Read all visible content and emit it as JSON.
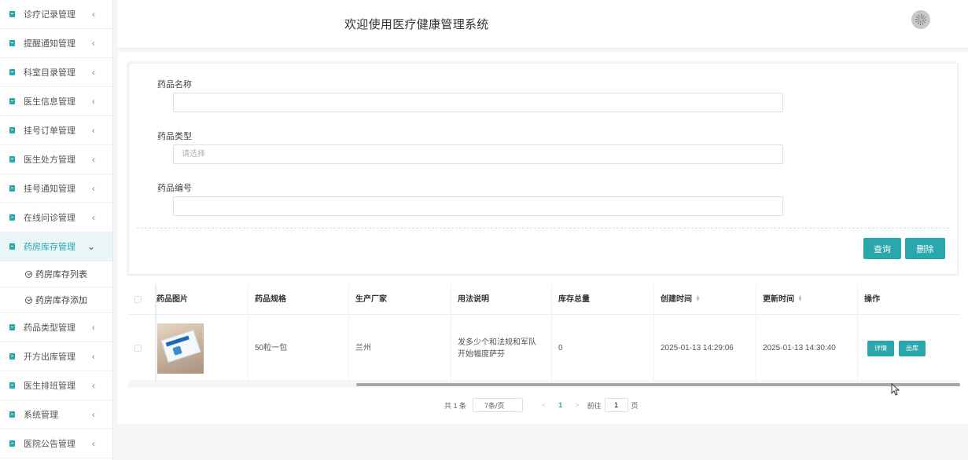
{
  "sidebar": {
    "items": [
      {
        "label": "诊疗记录管理"
      },
      {
        "label": "提醒通知管理"
      },
      {
        "label": "科室目录管理"
      },
      {
        "label": "医生信息管理"
      },
      {
        "label": "挂号订单管理"
      },
      {
        "label": "医生处方管理"
      },
      {
        "label": "挂号通知管理"
      },
      {
        "label": "在线问诊管理"
      },
      {
        "label": "药房库存管理",
        "active": true
      },
      {
        "label": "药品类型管理"
      },
      {
        "label": "开方出库管理"
      },
      {
        "label": "医生排班管理"
      },
      {
        "label": "系统管理"
      },
      {
        "label": "医院公告管理"
      }
    ],
    "submenu": [
      {
        "label": "药房库存列表"
      },
      {
        "label": "药房库存添加"
      }
    ],
    "chevron_right": "‹",
    "chevron_down": "⌄",
    "accent_color": "#2aa6ad"
  },
  "header": {
    "title": "欢迎使用医疗健康管理系统",
    "avatar_icon": "loading-spinner-icon"
  },
  "search_form": {
    "name_label": "药品名称",
    "name_value": "",
    "type_label": "药品类型",
    "type_placeholder": "请选择",
    "code_label": "药品编号",
    "code_value": "",
    "query_button": "查询",
    "delete_button": "删除"
  },
  "table": {
    "columns": [
      "药品图片",
      "药品规格",
      "生产厂家",
      "用法说明",
      "库存总量",
      "创建时间",
      "更新时间",
      "操作"
    ],
    "rows": [
      {
        "image_alt": "medicine-box-photo",
        "spec": "50粒一包",
        "manufacturer": "兰州",
        "usage": "发多少个和法规和军队开始幅度萨芬",
        "stock": "0",
        "created": "2025-01-13 14:29:06",
        "updated": "2025-01-13 14:30:40",
        "detail_button": "详情",
        "outbound_button": "出库"
      }
    ]
  },
  "pagination": {
    "total": "共 1 条",
    "page_size": "7条/页",
    "prev": "<",
    "current": "1",
    "next": ">",
    "goto_prefix": "前往",
    "goto_value": "1",
    "goto_suffix": "页"
  }
}
